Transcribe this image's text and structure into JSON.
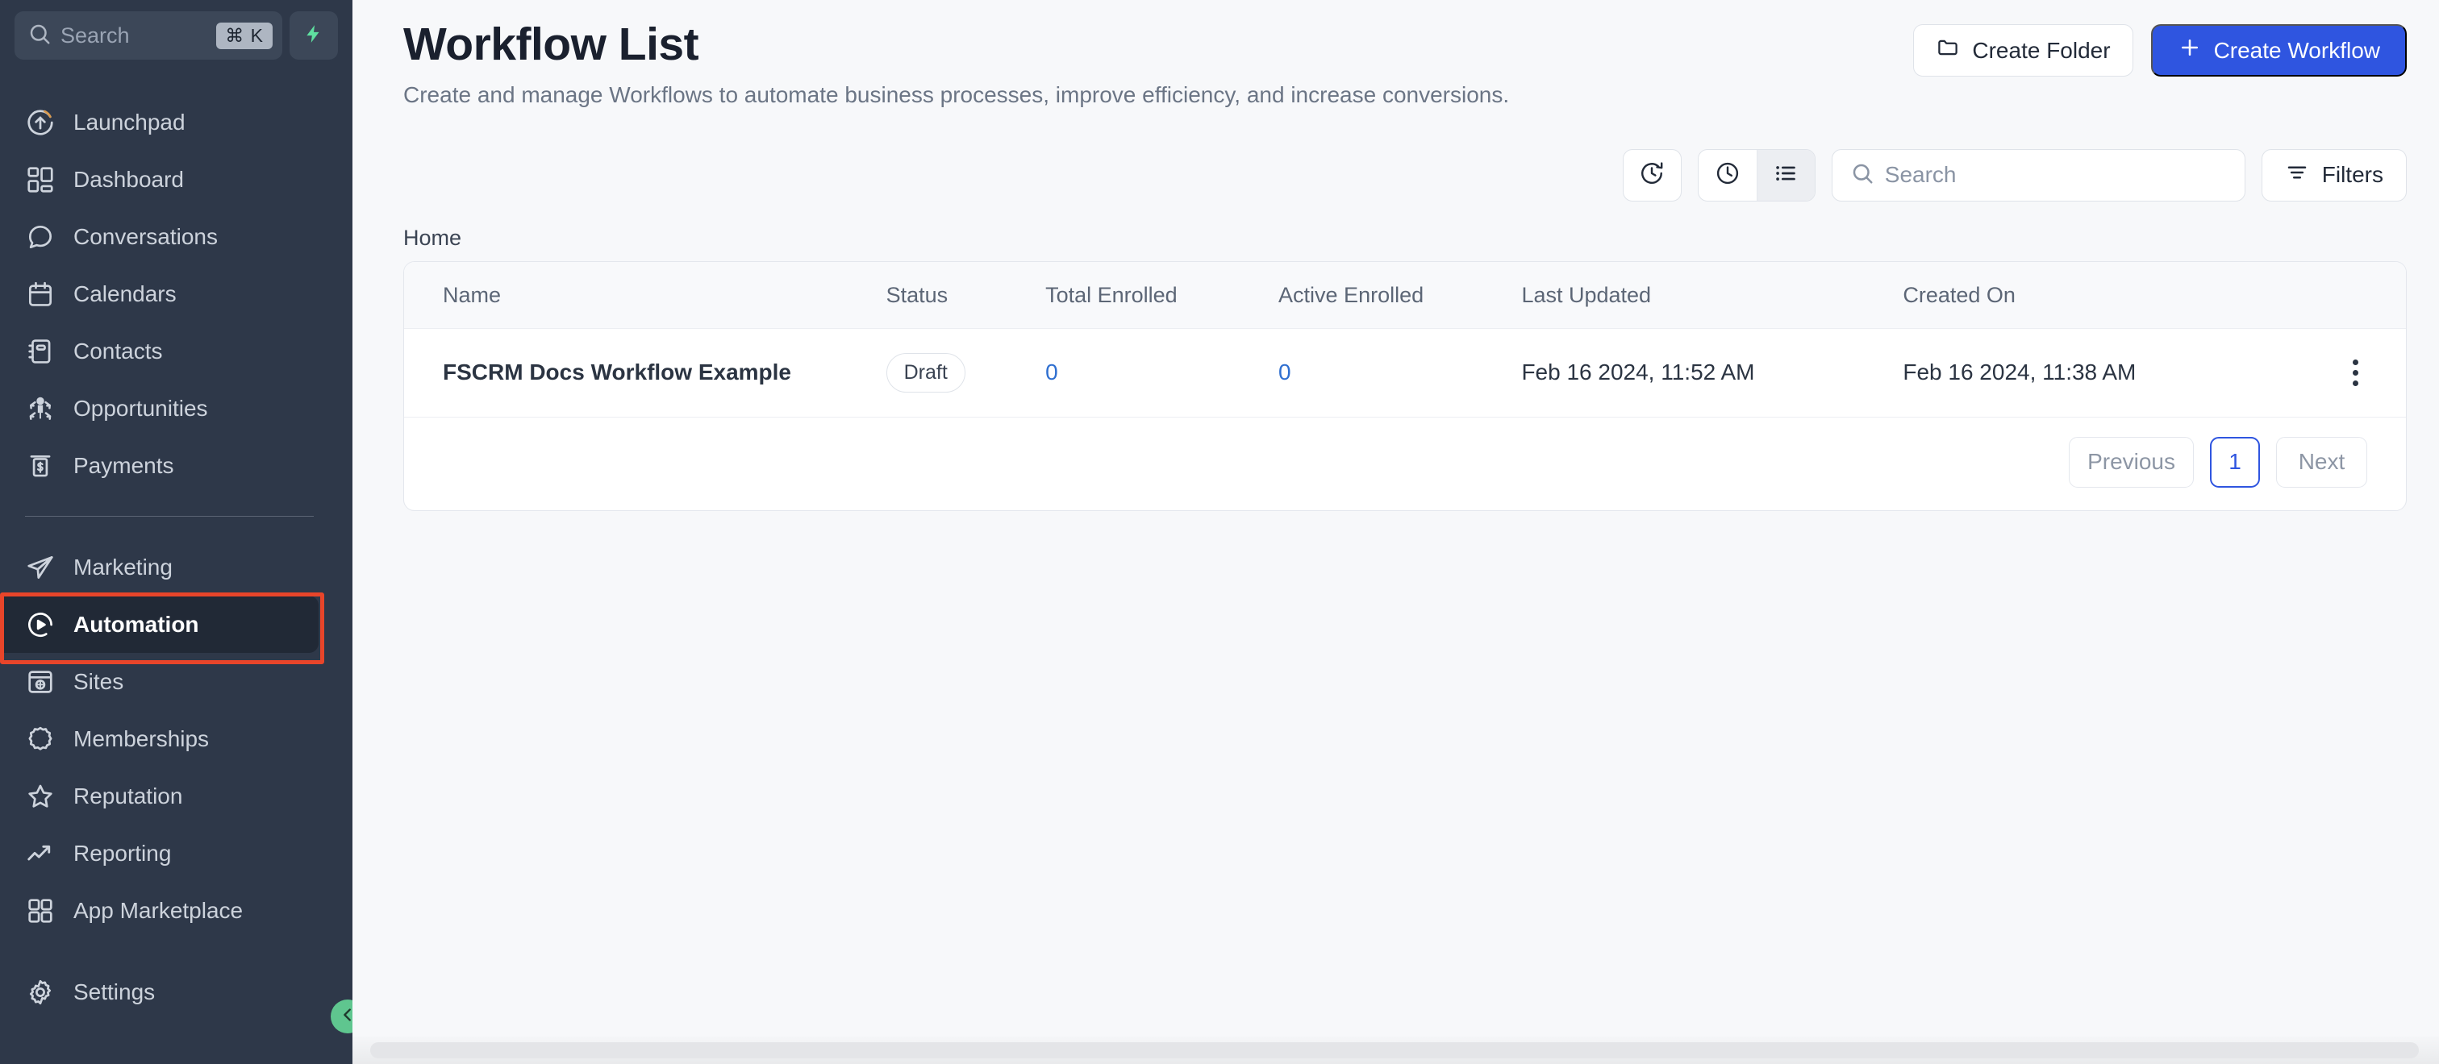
{
  "sidebar": {
    "search": {
      "placeholder": "Search",
      "shortcut": "⌘ K",
      "icon": "search-icon",
      "bolt_icon": "bolt-icon"
    },
    "items_top": [
      {
        "label": "Launchpad",
        "icon": "rocket-launchpad-icon"
      },
      {
        "label": "Dashboard",
        "icon": "dashboard-grid-icon"
      },
      {
        "label": "Conversations",
        "icon": "chat-bubble-icon"
      },
      {
        "label": "Calendars",
        "icon": "calendar-icon"
      },
      {
        "label": "Contacts",
        "icon": "contacts-book-icon"
      },
      {
        "label": "Opportunities",
        "icon": "opportunities-icon"
      },
      {
        "label": "Payments",
        "icon": "payments-icon"
      }
    ],
    "items_bottom": [
      {
        "label": "Marketing",
        "icon": "paper-plane-icon",
        "active": false
      },
      {
        "label": "Automation",
        "icon": "automation-play-icon",
        "active": true,
        "highlighted": true
      },
      {
        "label": "Sites",
        "icon": "sites-globe-icon",
        "active": false
      },
      {
        "label": "Memberships",
        "icon": "memberships-badge-icon",
        "active": false
      },
      {
        "label": "Reputation",
        "icon": "star-icon",
        "active": false
      },
      {
        "label": "Reporting",
        "icon": "trending-up-icon",
        "active": false
      },
      {
        "label": "App Marketplace",
        "icon": "app-grid-icon",
        "active": false
      }
    ],
    "settings": {
      "label": "Settings",
      "icon": "gear-icon"
    },
    "collapse": {
      "icon": "chevron-left-icon"
    },
    "colors": {
      "background": "#2e3849",
      "active_background": "#212936",
      "highlight": "#e8452a",
      "collapse": "#5fc68f"
    }
  },
  "header": {
    "title": "Workflow List",
    "subtitle": "Create and manage Workflows to automate business processes, improve efficiency, and increase conversions.",
    "create_folder": {
      "label": "Create Folder",
      "icon": "folder-icon"
    },
    "create_workflow": {
      "label": "Create Workflow",
      "icon": "plus-icon",
      "color": "#2f55e0"
    }
  },
  "toolbar": {
    "history_button": {
      "icon": "clock-rotate-icon"
    },
    "view_clock": {
      "icon": "clock-icon",
      "active": false
    },
    "view_list": {
      "icon": "list-icon",
      "active": true
    },
    "search": {
      "placeholder": "Search",
      "value": "",
      "icon": "search-icon"
    },
    "filters": {
      "label": "Filters",
      "icon": "filter-lines-icon"
    }
  },
  "breadcrumb": {
    "label": "Home"
  },
  "table": {
    "columns": [
      "Name",
      "Status",
      "Total Enrolled",
      "Active Enrolled",
      "Last Updated",
      "Created On"
    ],
    "rows": [
      {
        "name": "FSCRM Docs Workflow Example",
        "status": "Draft",
        "total_enrolled": "0",
        "active_enrolled": "0",
        "last_updated": "Feb 16 2024, 11:52 AM",
        "created_on": "Feb 16 2024, 11:38 AM",
        "menu_icon": "kebab-menu-icon"
      }
    ]
  },
  "pagination": {
    "previous": "Previous",
    "current_page": "1",
    "next": "Next"
  }
}
